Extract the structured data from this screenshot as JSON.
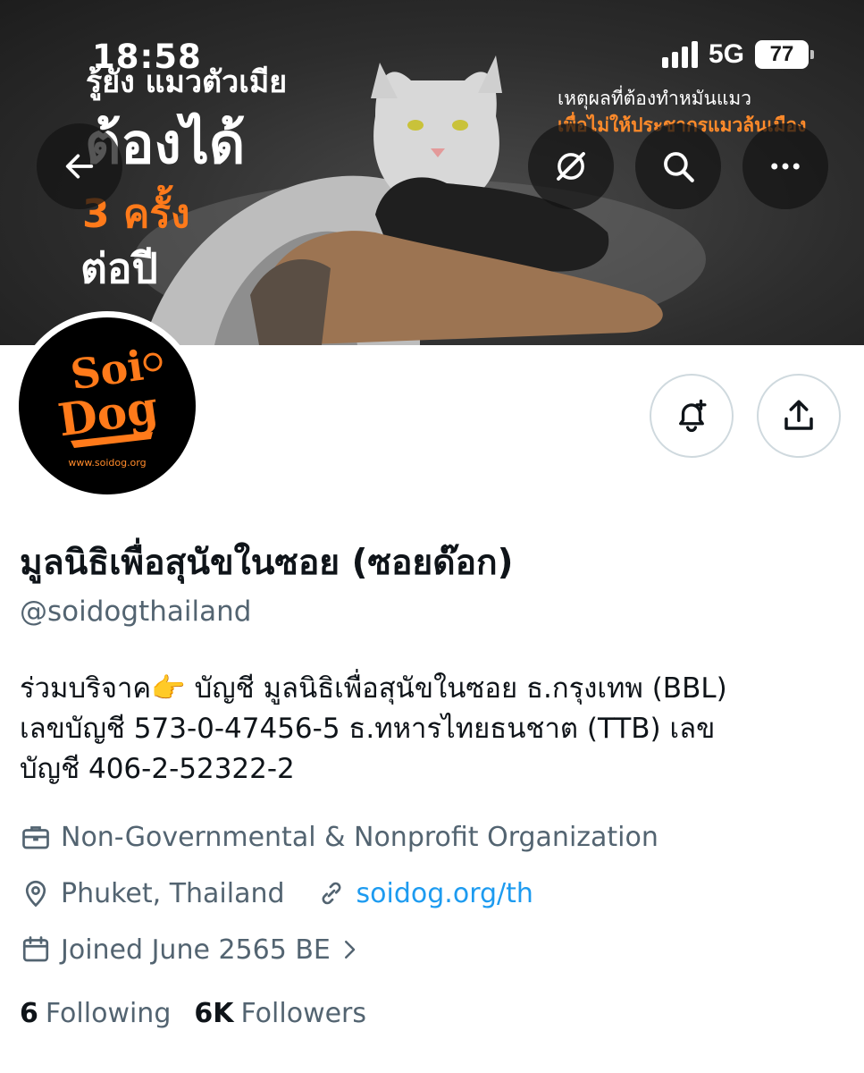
{
  "status_bar": {
    "time": "18:58",
    "network": "5G",
    "battery": "77"
  },
  "banner": {
    "left_text": [
      "รู้ยัง แมวตัวเมีย",
      "ต้องได้",
      "3 ครั้ง",
      "ต่อปี"
    ],
    "right_text": [
      "เหตุผลที่ต้องทำหมันแมว",
      "เพื่อไม่ให้ประชากรแมวล้นเมือง"
    ]
  },
  "top_actions": {
    "back_icon": "arrow-left-icon",
    "grok_icon": "grok-slash-icon",
    "search_icon": "search-icon",
    "more_icon": "more-horizontal-icon"
  },
  "avatar": {
    "logo_line1": "Soi",
    "logo_line2": "Dog",
    "url": "www.soidog.org"
  },
  "profile_actions": {
    "notify_icon": "bell-plus-icon",
    "share_icon": "share-upload-icon"
  },
  "profile": {
    "name": "มูลนิธิเพื่อสุนัขในซอย (ซอยด๊อก)",
    "handle": "@soidogthailand",
    "bio_lines": [
      "ร่วมบริจาค👉 บัญชี มูลนิธิเพื่อสุนัขในซอย ธ.กรุงเทพ (BBL)",
      "เลขบัญชี 573-0-47456-5 ธ.ทหารไทยธนชาต (TTB) เลข",
      "บัญชี 406-2-52322-2"
    ],
    "category": "Non-Governmental & Nonprofit Organization",
    "location": "Phuket, Thailand",
    "website": "soidog.org/th",
    "joined": "Joined June 2565 BE",
    "following_count": "6",
    "following_label": "Following",
    "followers_count": "6K",
    "followers_label": "Followers"
  },
  "colors": {
    "accent_link": "#1d9bf0",
    "secondary_text": "#536471",
    "brand_orange": "#ff7a1a"
  }
}
